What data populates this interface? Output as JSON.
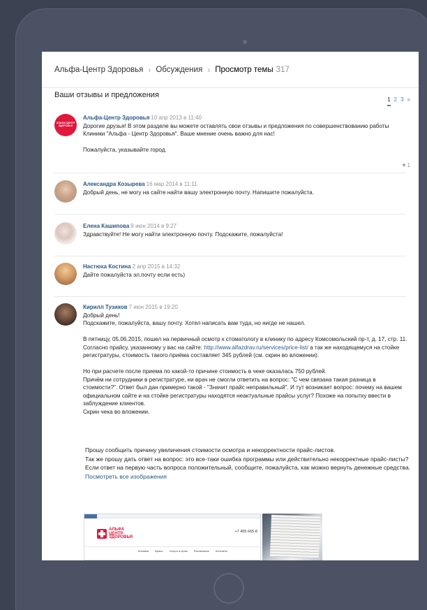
{
  "breadcrumb": {
    "group": "Альфа-Центр Здоровья",
    "section": "Обсуждения",
    "current": "Просмотр темы",
    "count": "317"
  },
  "topic": {
    "title": "Ваши отзывы и предложения",
    "pages": [
      "1",
      "2",
      "3",
      "»"
    ]
  },
  "posts": [
    {
      "author": "Альфа-Центр Здоровья",
      "date": "10 апр 2013 в 11:40",
      "lines": [
        "Дорогие друзья! В этом разделе вы можете оставлять свои отзывы и предложения по совершенствованию работы Клиники \"Альфа - Центр Здоровья\". Ваше мнение очень важно для нас!",
        "Пожалуйста, указывайте город."
      ],
      "likes": "1",
      "avatar_text": "АЛЬФА ЦЕНТР ЗДОРОВЬЯ"
    },
    {
      "author": "Александра Козырева",
      "date": "16 мар 2014 в 11:11",
      "lines": [
        "Добрый день, не могу на сайте найти вашу электронную почту. Напишите пожалуйста."
      ]
    },
    {
      "author": "Елена Кашипова",
      "date": "9 июн 2014 в 9:27",
      "lines": [
        "Здравствуйте! Не могу найти электронную почту. Подскажите, пожалуйста!"
      ]
    },
    {
      "author": "Настюха Костина",
      "date": "2 апр 2015 в 14:32",
      "lines": [
        "Дайте пожалуйста эл.почту если есть)"
      ]
    },
    {
      "author": "Кирилл Тузиков",
      "date": "7 июн 2015 в 19:20",
      "p1": "Добрый день!",
      "p2": "Подскажите, пожалуйста, вашу почту. Хотел написать вам туда, но нигде не нашел.",
      "p3": "В пятницу, 05.06.2015, пошел на первичный осмотр к стоматологу в клинику по адресу Комсомольский пр-т, д. 17, стр. 11.",
      "p4a": "Согласно прайсу, указанному у вас на сайте: ",
      "p4link": "http://www.alfazdrav.ru/services/price-list/",
      "p4b": " а так же находящемуся на стойке регистратуры, стоимость такого приёма составляет 345 рублей (см. скрин во вложении).",
      "p5": "Но при расчете после приема по какой-то причине стоимость в чеке оказалась 750 рублей.",
      "p6": "Причём ни сотрудники в регистратуре, ни врач не смогли ответить на вопрос: \"С чем связана такая разница в стоимости?\". Ответ был дан примерно такой - \"Значит прайс неправильный\". И тут возникает вопрос: почему на вашем официальном сайте и на стойке регистратуры находятся неактуальные прайсы услуг? Похоже на попытку ввести в заблуждение клиентов.",
      "p7": "Скрин чека во вложении."
    }
  ],
  "continuation": {
    "l1": "Прошу сообщить причину увеличения стоимости осмотра и некорректности прайс-листов.",
    "l2": "Так же прошу дать ответ на вопрос: это все-таки ошибка программы или действительно некорректные прайс-листы?",
    "l3": "Если ответ на первую часть вопроса положительный, сообщите, пожалуйста, как можно вернуть денежные средства.",
    "show_all": "Посмотреть все изображения"
  },
  "attachment_site": {
    "logo_line1": "АЛЬФА",
    "logo_line2": "ЦЕНТР",
    "logo_line3": "ЗДОРОВЬЯ",
    "phone": "+7 495 665-8",
    "nav": [
      "Клиники",
      "Врачи",
      "Услуги и цены",
      "Расписание",
      "Контакты"
    ]
  },
  "colors": {
    "background": "#3b4252",
    "tablet": "#4a5263",
    "link": "#2a5885",
    "brand_red": "#e2173b"
  }
}
